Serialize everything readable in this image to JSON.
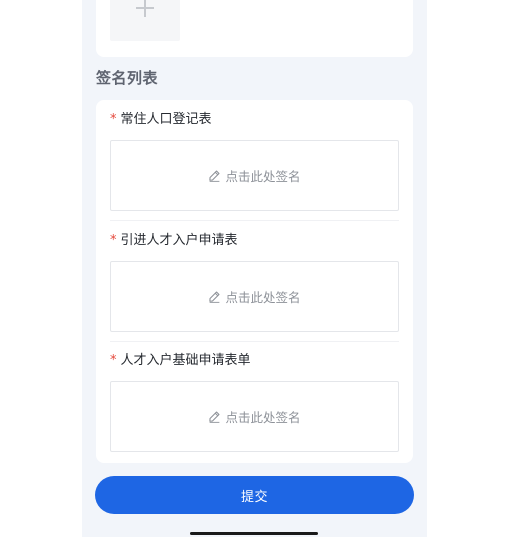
{
  "upload": {
    "icon": "plus-icon"
  },
  "signature_section": {
    "title": "签名列表",
    "items": [
      {
        "required_mark": "*",
        "label": "常住人口登记表",
        "hint": "点击此处签名",
        "icon": "pencil-icon"
      },
      {
        "required_mark": "*",
        "label": "引进人才入户申请表",
        "hint": "点击此处签名",
        "icon": "pencil-icon"
      },
      {
        "required_mark": "*",
        "label": "人才入户基础申请表单",
        "hint": "点击此处签名",
        "icon": "pencil-icon"
      }
    ]
  },
  "actions": {
    "submit_label": "提交"
  },
  "colors": {
    "primary": "#1e66e4",
    "required": "#e5483b",
    "page_background": "#f2f5fa",
    "card_background": "#ffffff"
  }
}
